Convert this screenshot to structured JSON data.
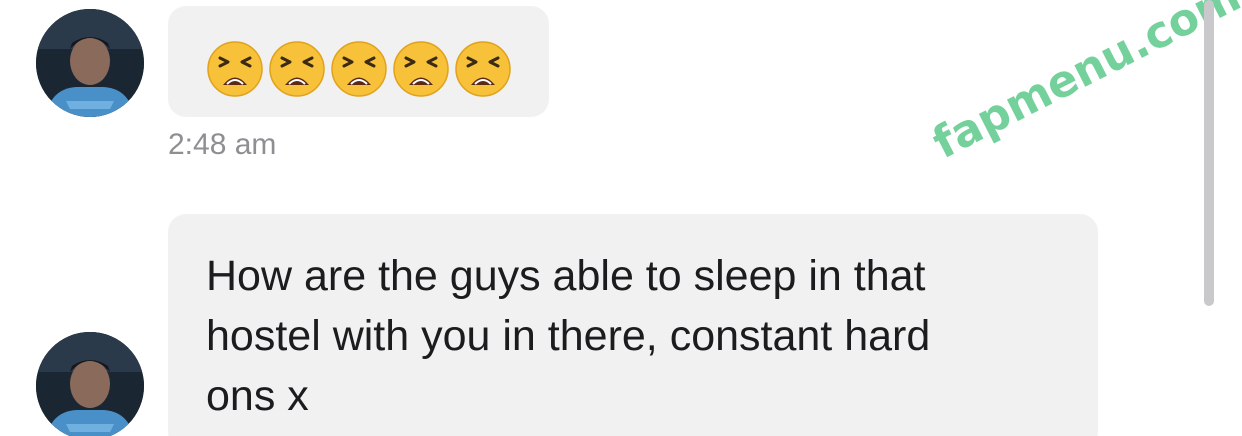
{
  "messages": [
    {
      "emojis": [
        "tired-face",
        "tired-face",
        "tired-face",
        "tired-face",
        "tired-face"
      ],
      "timestamp": "2:48 am"
    },
    {
      "text": "How are the guys able to sleep in that\nhostel with you in there, constant hard\nons x"
    }
  ],
  "watermark": "fapmenu.com",
  "colors": {
    "bubble": "#f1f1f2",
    "timestamp": "#8e8e93",
    "watermark": "#5cc98a",
    "emoji_face": "#f7c23a"
  }
}
